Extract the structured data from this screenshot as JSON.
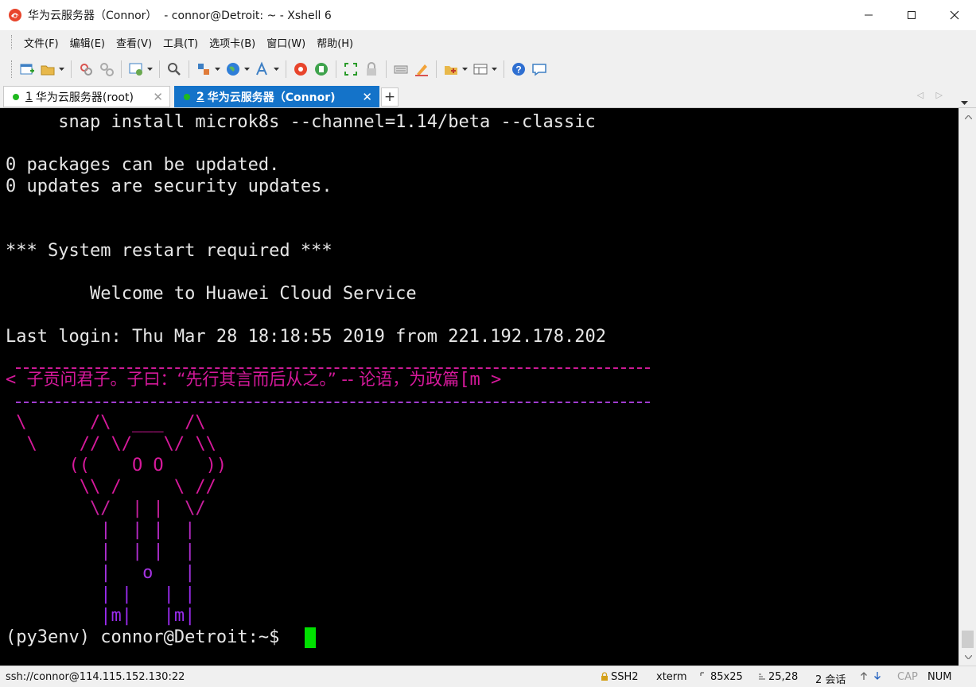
{
  "window": {
    "title": "华为云服务器（Connor）  - connor@Detroit: ~ - Xshell 6"
  },
  "menu": [
    "文件(F)",
    "编辑(E)",
    "查看(V)",
    "工具(T)",
    "选项卡(B)",
    "窗口(W)",
    "帮助(H)"
  ],
  "toolbar": {
    "icons": [
      "new-session-icon",
      "open-folder-icon",
      "reconnect-icon",
      "disconnect-icon",
      "properties-icon",
      "find-icon",
      "transfer-icon",
      "globe-icon",
      "font-icon",
      "xshell-icon",
      "xftp-icon",
      "fullscreen-icon",
      "lock-icon",
      "keyboard-icon",
      "highlight-icon",
      "add-folder-icon",
      "layout-icon",
      "help-icon",
      "chat-icon"
    ]
  },
  "tabs": [
    {
      "number": "1",
      "label": "华为云服务器(root)",
      "active": false,
      "status_color": "#1fb91f"
    },
    {
      "number": "2",
      "label": "华为云服务器（Connor)",
      "active": true,
      "status_color": "#1fb91f"
    }
  ],
  "tab_controls": {
    "add": "+",
    "close": "✕",
    "nav": "◁ ▷"
  },
  "terminal": {
    "lines": [
      "     snap install microk8s --channel=1.14/beta --classic",
      "0 packages can be updated.",
      "0 updates are security updates.",
      "*** System restart required ***",
      "        Welcome to Huawei Cloud Service",
      "Last login: Thu Mar 28 18:18:55 2019 from 221.192.178.202"
    ],
    "cowsay": {
      "open": "< ",
      "quote": "子贡问君子。子曰：“先行其言而后从之。” -- 论语，为政篇",
      "tail": "[m >",
      "art": [
        " \\      /\\  ___  /\\",
        "  \\    // \\/   \\/ \\\\",
        "      ((    O O    ))",
        "       \\\\ /     \\ //",
        "        \\/  | |  \\/",
        "         |  | |  |",
        "         |  | |  |",
        "         |   o   |",
        "         | |   | |",
        "         |m|   |m|"
      ]
    },
    "prompt": "(py3env) connor@Detroit:~$ ",
    "colors": {
      "fg": "#e6e6e6",
      "bg": "#000000",
      "magenta": "#d6199b",
      "purple": "#9b2cf0",
      "cursor": "#00e000"
    }
  },
  "status": {
    "connection": "ssh://connor@114.115.152.130:22",
    "protocol": "SSH2",
    "term": "xterm",
    "size": "85x25",
    "position": "25,28",
    "sessions": "2 会话",
    "cap": "CAP",
    "num": "NUM"
  }
}
